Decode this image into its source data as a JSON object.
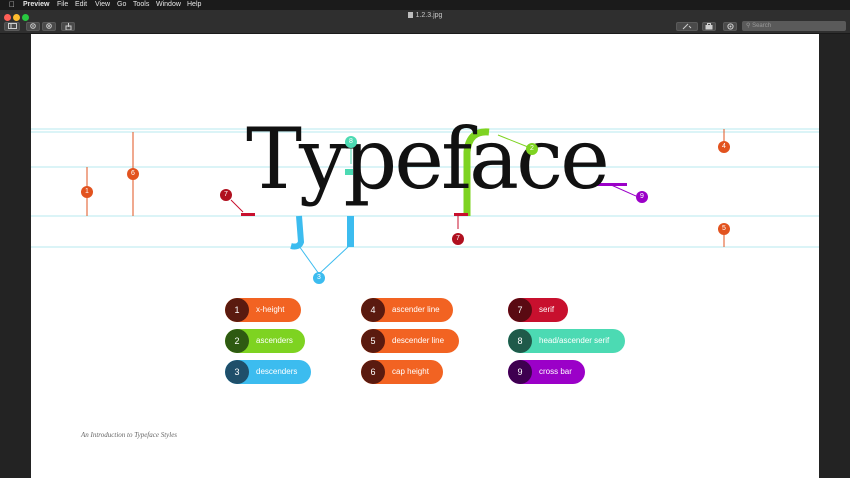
{
  "menubar": {
    "apple": "",
    "app_name": "Preview",
    "items": [
      "File",
      "Edit",
      "View",
      "Go",
      "Tools",
      "Window",
      "Help"
    ]
  },
  "window": {
    "title": "1.2.3.jpg",
    "search_placeholder": "Search",
    "traffic_colors": [
      "#ff5f57",
      "#febc2e",
      "#28c840"
    ]
  },
  "toolbar_icons": [
    "sidebar-toggle-icon",
    "zoom-out-icon",
    "zoom-in-icon",
    "share-icon",
    "markup-pen-icon",
    "briefcase-icon",
    "rotate-icon"
  ],
  "slide": {
    "word": "Typeface",
    "caption": "An Introduction to Typeface Styles",
    "callouts": [
      "1",
      "6",
      "7",
      "8",
      "2",
      "4",
      "9",
      "7",
      "5",
      "3"
    ],
    "legend": [
      {
        "n": "1",
        "label": "x-height",
        "color": "#f26322",
        "dark": "#5a1a0f"
      },
      {
        "n": "2",
        "label": "ascenders",
        "color": "#7ed321",
        "dark": "#2e5a12"
      },
      {
        "n": "3",
        "label": "descenders",
        "color": "#3cbcef",
        "dark": "#1f4f6a"
      },
      {
        "n": "4",
        "label": "ascender line",
        "color": "#f26322",
        "dark": "#5a1a0f"
      },
      {
        "n": "5",
        "label": "descender line",
        "color": "#f26322",
        "dark": "#5a1a0f"
      },
      {
        "n": "6",
        "label": "cap height",
        "color": "#f26322",
        "dark": "#5a1a0f"
      },
      {
        "n": "7",
        "label": "serif",
        "color": "#c8102e",
        "dark": "#5a0a12"
      },
      {
        "n": "8",
        "label": "head/ascender serif",
        "color": "#4cdab3",
        "dark": "#1f5a4a"
      },
      {
        "n": "9",
        "label": "cross bar",
        "color": "#9b00c8",
        "dark": "#3e0050"
      }
    ]
  }
}
